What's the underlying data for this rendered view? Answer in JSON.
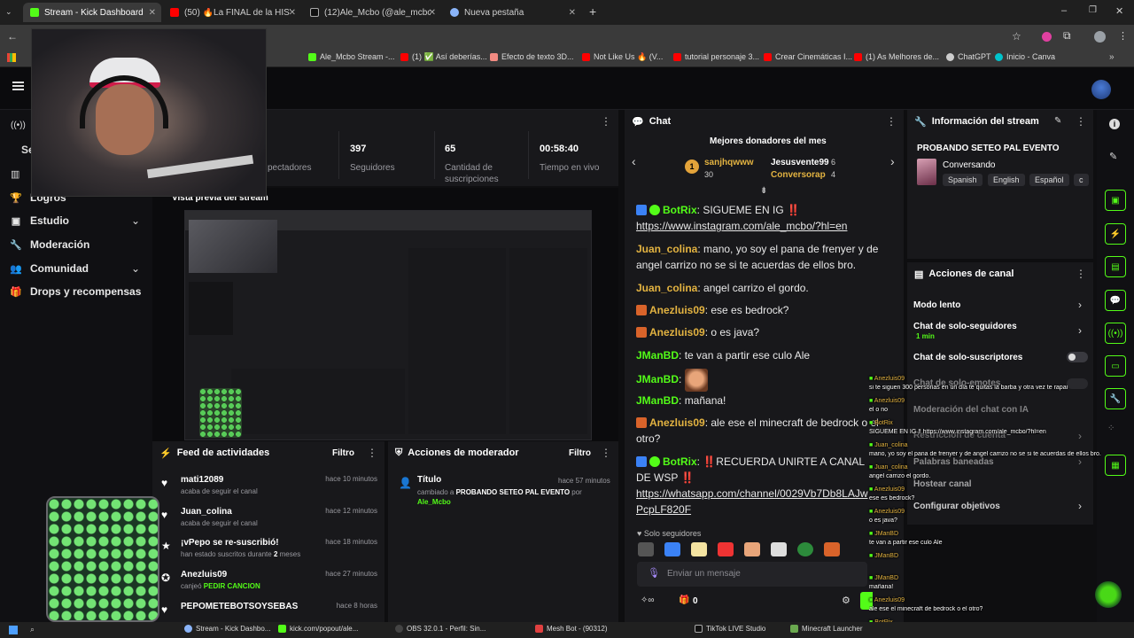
{
  "browser": {
    "tabs": [
      {
        "label": "Stream - Kick Dashboard",
        "color": "#53fc18"
      },
      {
        "label": "(50) 🔥La FINAL de la HISTORIA",
        "color": "#ff0000"
      },
      {
        "label": "(12)Ale_Mcbo (@ale_mcbo) | Ti",
        "color": "#111111"
      },
      {
        "label": "Nueva pestaña",
        "color": "#8ab4f8"
      }
    ],
    "bookmarks": [
      {
        "label": "Ale_Mcbo Stream -...",
        "color": "#53fc18"
      },
      {
        "label": "(1) ✅ Así deberías...",
        "color": "#ff0000"
      },
      {
        "label": "Efecto de texto 3D...",
        "color": "#f28b82"
      },
      {
        "label": "Not Like Us 🔥 (V...",
        "color": "#ff0000"
      },
      {
        "label": "tutorial personaje 3...",
        "color": "#ff0000"
      },
      {
        "label": "Crear Cinemáticas I...",
        "color": "#ff0000"
      },
      {
        "label": "(1) As Melhores de...",
        "color": "#ff0000"
      },
      {
        "label": "ChatGPT",
        "color": "#cccccc"
      },
      {
        "label": "Inicio - Canva",
        "color": "#00c4cc"
      }
    ]
  },
  "sidebar": {
    "partial_top": "Se",
    "items": [
      {
        "label": "Logros",
        "icon": "trophy-icon"
      },
      {
        "label": "Estudio",
        "icon": "studio-icon",
        "expand": true
      },
      {
        "label": "Moderación",
        "icon": "wrench-icon"
      },
      {
        "label": "Comunidad",
        "icon": "community-icon",
        "expand": true
      },
      {
        "label": "Drops y recompensas",
        "icon": "drops-icon"
      }
    ]
  },
  "stats": {
    "viewers_label": "pectadores",
    "followers": {
      "value": "397",
      "label": "Seguidores"
    },
    "subs": {
      "value": "65",
      "label": "Cantidad de suscripciones"
    },
    "live": {
      "value": "00:58:40",
      "label": "Tiempo en vivo"
    }
  },
  "preview": {
    "title": "Vista previa del stream"
  },
  "activity_feed": {
    "title": "Feed de actividades",
    "filter": "Filtro",
    "items": [
      {
        "name": "mati12089",
        "sub": "acaba de seguir el canal",
        "time": "hace 10 minutos"
      },
      {
        "name": "Juan_colina",
        "sub": "acaba de seguir el canal",
        "time": "hace 12 minutos"
      },
      {
        "name": "¡vPepo se re-suscribió!",
        "sub_pre": "han estado suscritos durante ",
        "sub_num": "2",
        "sub_post": " meses",
        "time": "hace 18 minutos"
      },
      {
        "name": "Anezluis09",
        "sub_pre": "canjeó ",
        "sub_reward": "PEDIR CANCION",
        "time": "hace 27 minutos"
      },
      {
        "name": "PEPOMETEBOTSOYSEBAS",
        "sub": "",
        "time": "hace 8 horas"
      }
    ]
  },
  "mod_actions": {
    "title": "Acciones de moderador",
    "filter": "Filtro",
    "item": {
      "title": "Título",
      "time": "hace 57 minutos",
      "desc_pre": "cambiado a ",
      "desc_bold": "PROBANDO SETEO PAL EVENTO",
      "desc_by": " por",
      "user": "Ale_Mcbo"
    }
  },
  "chat": {
    "title": "Chat",
    "donors_title": "Mejores donadores del mes",
    "donors": [
      {
        "rank": "1",
        "name": "sanjhqwww",
        "amount": "30"
      },
      {
        "name": "Jesusvente99",
        "amount": "6"
      },
      {
        "name": "Conversorap",
        "amount": "4"
      }
    ],
    "messages": [
      {
        "user": "BotRix",
        "text": "SIGUEME EN IG ‼️",
        "link": "https://www.instagram.com/ale_mcbo/?hl=en"
      },
      {
        "user": "Juan_colina",
        "text": "mano, yo soy el pana de frenyer y de angel carrizo no se si te acuerdas de ellos bro."
      },
      {
        "user": "Juan_colina",
        "text": "angel carrizo el gordo."
      },
      {
        "user": "Anezluis09",
        "text": "ese es bedrock?"
      },
      {
        "user": "Anezluis09",
        "text": "o es java?"
      },
      {
        "user": "JManBD",
        "text": "te van a partir ese culo Ale"
      },
      {
        "user": "JManBD",
        "text": ""
      },
      {
        "user": "JManBD",
        "text": "mañana!"
      },
      {
        "user": "Anezluis09",
        "text": "ale ese el minecraft de bedrock o el otro?"
      },
      {
        "user": "BotRix",
        "text": "‼️RECUERDA UNIRTE A CANAL DE WSP ‼️",
        "link": "https://whatsapp.com/channel/0029Vb7Db8LAJwPcpLF820F"
      }
    ],
    "followers_only": "Solo seguidores",
    "input_placeholder": "Enviar un mensaje",
    "footer_count": "0"
  },
  "info": {
    "title": "Información del stream",
    "stream_title": "PROBANDO SETEO PAL EVENTO",
    "category": "Conversando",
    "tags": [
      "Spanish",
      "English",
      "Español",
      "c"
    ]
  },
  "channel_actions": {
    "title": "Acciones de canal",
    "items": [
      {
        "label": "Modo lento"
      },
      {
        "label": "Chat de solo-seguidores",
        "sub": "1 min"
      },
      {
        "label": "Chat de solo-suscriptores"
      },
      {
        "label": "Chat de solo-emotes"
      },
      {
        "label": "Moderación del chat con IA"
      },
      {
        "label": "Restricción de cuenta"
      },
      {
        "label": "Palabras baneadas"
      },
      {
        "label": "Hostear canal"
      },
      {
        "label": "Configurar objetivos"
      }
    ]
  },
  "overlay_chat": [
    {
      "user": "Anezluis09",
      "text": "si te siguen 300 personas en un día te quitas la barba y otra vez te rapai"
    },
    {
      "user": "Anezluis09",
      "text": "el o no"
    },
    {
      "user": "BotRix",
      "text": "SIGUEME EN IG ‼  https://www.instagram.com/ale_mcbo/?hl=en"
    },
    {
      "user": "Juan_colina",
      "text": "mano, yo soy el pana de frenyer y de angel carrizo no se si te acuerdas de ellos bro."
    },
    {
      "user": "Juan_colina",
      "text": "angel carrizo el gordo."
    },
    {
      "user": "Anezluis09",
      "text": "ese es bedrock?"
    },
    {
      "user": "Anezluis09",
      "text": "o es java?"
    },
    {
      "user": "JManBD",
      "text": "te van a partir ese culo Ale"
    },
    {
      "user": "JManBD",
      "text": ""
    },
    {
      "user": "JManBD",
      "text": "mañana!"
    },
    {
      "user": "Anezluis09",
      "text": "ale ese el minecraft de bedrock o el otro?"
    },
    {
      "user": "BotRix",
      "text": "RECUERDA UNIRTE AL CANAL DE WSP  https://whatsapp.com/channel/0029Vb7Db8LAJwPcpLF820F"
    }
  ],
  "taskbar": [
    {
      "label": "Stream - Kick Dashbo...",
      "color": "#8ab4f8"
    },
    {
      "label": "kick.com/popout/ale...",
      "color": "#53fc18"
    },
    {
      "label": "OBS 32.0.1 - Perfil: Sin...",
      "color": "#444444"
    },
    {
      "label": "Mesh Bot - (90312)",
      "color": "#e04040"
    },
    {
      "label": "TikTok LIVE Studio",
      "color": "#111111"
    },
    {
      "label": "Minecraft Launcher",
      "color": "#6aa84f"
    }
  ],
  "colors": {
    "accent": "#53fc18",
    "panel": "#18181b",
    "bg": "#0e0e10"
  }
}
